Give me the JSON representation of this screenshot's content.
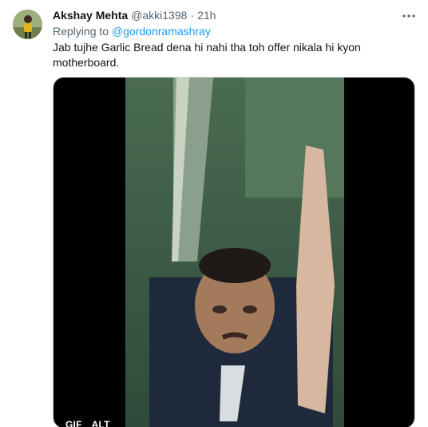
{
  "tweet": {
    "display_name": "Akshay Mehta",
    "handle": "@akki1398",
    "separator": "·",
    "time": "21h",
    "replying_prefix": "Replying to",
    "replying_to": "@gordonramashray",
    "text": "Jab tujhe Garlic Bread dena hi nahi tha toh offer nikala hi kyon motherboard."
  },
  "media": {
    "badges": [
      "GIF",
      "ALT"
    ]
  },
  "icons": {
    "more": "more-horizontal-icon"
  },
  "colors": {
    "link": "#1d9bf0",
    "secondary_text": "#536471",
    "primary_text": "#0f1419"
  }
}
